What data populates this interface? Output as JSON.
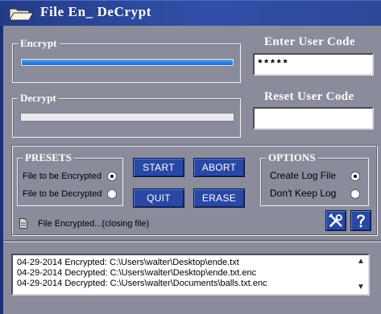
{
  "window": {
    "title": "File En_ DeCrypt"
  },
  "encrypt": {
    "label": "Encrypt",
    "progress": 1.0
  },
  "decrypt": {
    "label": "Decrypt",
    "progress": 0.0
  },
  "user_code": {
    "label": "Enter User Code",
    "value": "*****"
  },
  "reset_code": {
    "label": "Reset User Code",
    "value": ""
  },
  "presets": {
    "label": "PRESETS",
    "options": [
      {
        "label": "File to be Encrypted",
        "checked": true
      },
      {
        "label": "File to be Decrypted",
        "checked": false
      }
    ]
  },
  "buttons": {
    "start": "START",
    "abort": "ABORT",
    "quit": "QUIT",
    "erase": "ERASE"
  },
  "options": {
    "label": "OPTIONS",
    "items": [
      {
        "label": "Create Log File",
        "checked": true
      },
      {
        "label": "Don't Keep Log",
        "checked": false
      }
    ]
  },
  "status": {
    "text": "File Encrypted...(closing file)"
  },
  "log": {
    "lines": [
      "04-29-2014 Encrypted: C:\\Users\\walter\\Desktop\\ende.txt",
      "04-29-2014 Decrypted: C:\\Users\\walter\\Desktop\\ende.txt.enc",
      "04-29-2014 Decrypted: C:\\Users\\walter\\Documents\\balls.txt.enc"
    ]
  },
  "icons": {
    "app": "folder-open-icon",
    "settings": "tools-icon",
    "help": "help-icon",
    "status": "document-icon",
    "scroll_up": "scroll-up-icon",
    "scroll_down": "scroll-down-icon"
  },
  "colors": {
    "title_bar": "#2c4898",
    "window_bg": "#8a8c9c",
    "button_bg": "#2848a4",
    "progress_fill": "#2f7ee0"
  }
}
